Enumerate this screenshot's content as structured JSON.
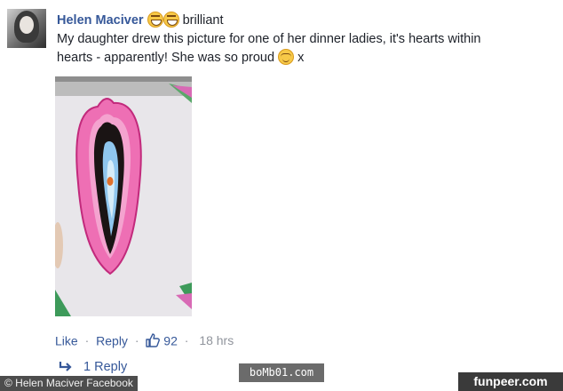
{
  "comment": {
    "author": "Helen Maciver",
    "header_text": "brilliant",
    "body_line1": "My daughter drew this picture for one of her dinner ladies, it's hearts within",
    "body_line2": "hearts - apparently! She was so proud",
    "body_suffix": "x",
    "emojis": [
      "laughing-emoji",
      "laughing-emoji",
      "smiling-emoji"
    ]
  },
  "actions": {
    "like": "Like",
    "separator": "·",
    "reply": "Reply",
    "like_count": "92",
    "time": "18 hrs"
  },
  "replies": {
    "label": "1 Reply"
  },
  "overlays": {
    "credit": "© Helen Maciver Facebook",
    "watermark_1": "boMb01.com",
    "watermark_2": "funpeer.com"
  },
  "colors": {
    "link": "#365899",
    "meta": "#90949c",
    "text": "#1d2129"
  }
}
